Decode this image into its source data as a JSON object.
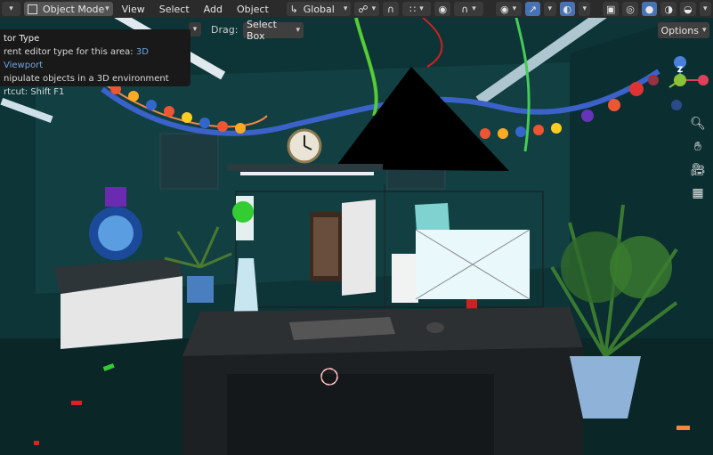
{
  "header": {
    "mode_label": "Object Mode",
    "menus": [
      "View",
      "Select",
      "Add",
      "Object"
    ],
    "transform_orientation": "Global"
  },
  "toolbar": {
    "drag_label": "Drag:",
    "drag_value": "Select Box",
    "options_label": "Options"
  },
  "tooltip": {
    "title": "tor Type",
    "line1_prefix": "rent editor type for this area:",
    "line1_accent": "3D Viewport",
    "line2": "nipulate objects in a 3D environment",
    "line3": "rtcut: Shift F1"
  },
  "gizmo": {
    "axis_z": "Z"
  },
  "colors": {
    "header_bg": "#2b2b2b",
    "button_bg": "#545454",
    "active_blue": "#4772b3",
    "tooltip_bg": "#191919",
    "tooltip_accent": "#6ea3e4",
    "axis_x": "#e0405a",
    "axis_y": "#8ac33a",
    "axis_z": "#4a7fdb"
  },
  "icons": {
    "editor_type": "object-mode-icon",
    "orientation": "transform-orientation-icon",
    "snap": "snap-magnet-icon",
    "proportional": "proportional-editing-icon",
    "overlay": "overlay-icon",
    "xray": "xray-icon",
    "shading": [
      "wireframe-shading-icon",
      "solid-shading-icon",
      "material-shading-icon",
      "rendered-shading-icon"
    ],
    "nav": [
      "zoom-icon",
      "hand-pan-icon",
      "camera-icon",
      "grid-icon"
    ]
  }
}
